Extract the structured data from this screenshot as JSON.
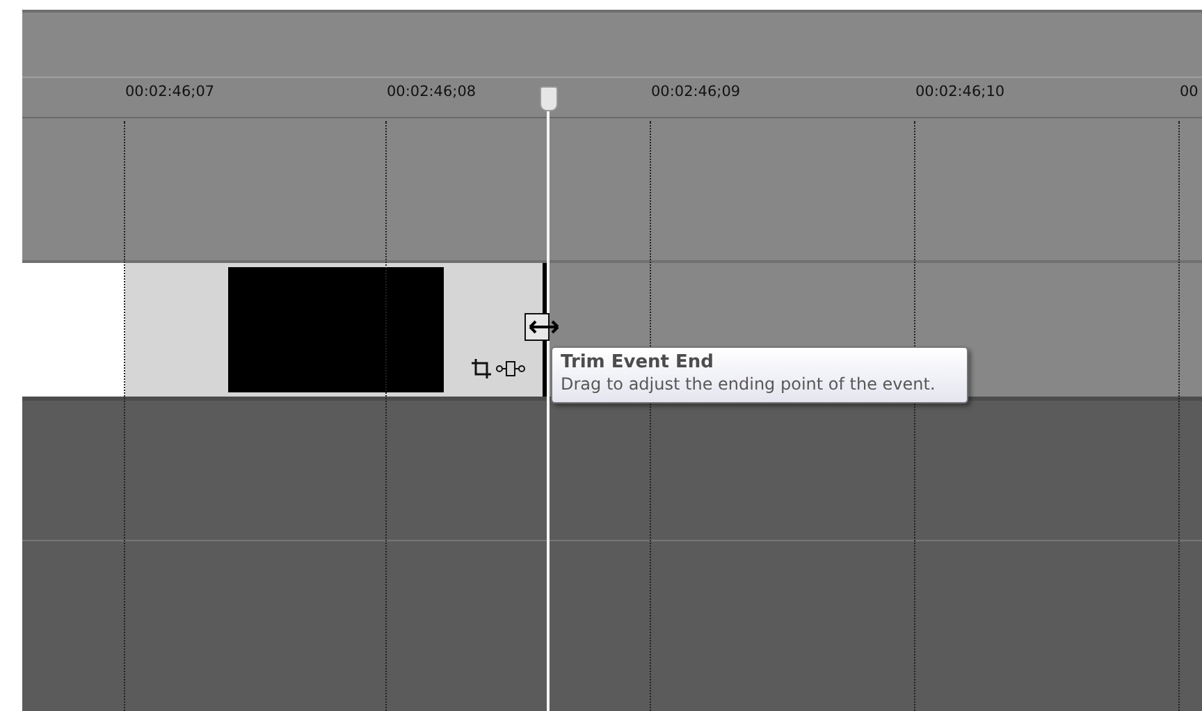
{
  "ruler": {
    "labels": [
      "00:02:46;07",
      "00:02:46;08",
      "00:02:46;09",
      "00:02:46;10",
      "00"
    ]
  },
  "event": {
    "frames": [
      {
        "kind": "white"
      },
      {
        "kind": "gray"
      },
      {
        "kind": "black"
      },
      {
        "kind": "gray"
      }
    ]
  },
  "tooltip": {
    "title": "Trim Event End",
    "text": "Drag to adjust the ending point of the event."
  }
}
